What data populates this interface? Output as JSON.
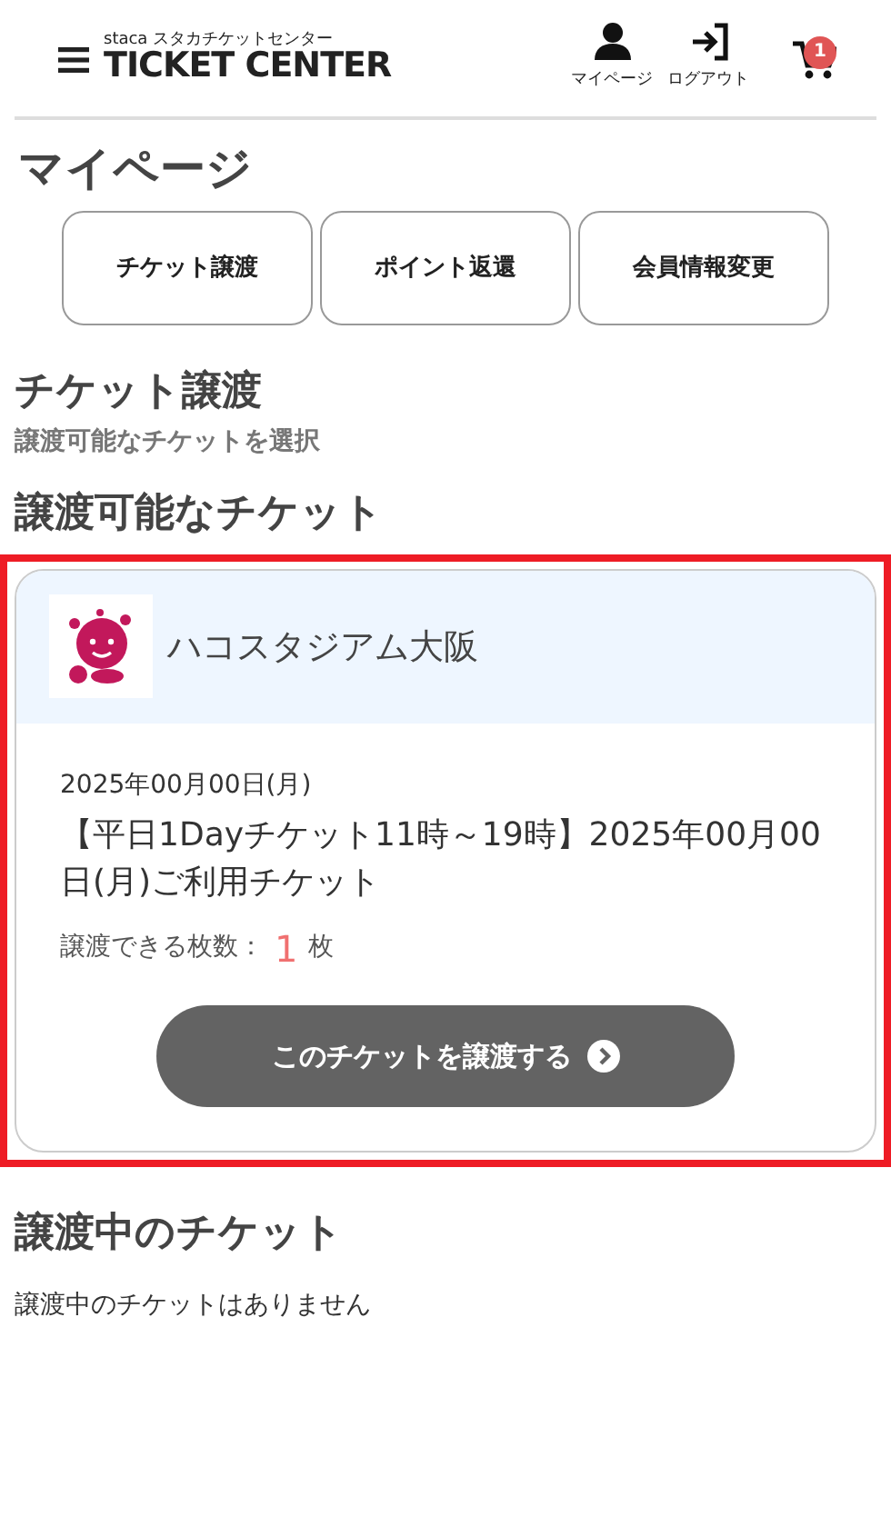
{
  "header": {
    "logo_small": "staca スタカチケットセンター",
    "logo_main": "TICKET CENTER",
    "nav": [
      {
        "kind": "user",
        "label": "マイページ"
      },
      {
        "kind": "logout",
        "label": "ログアウト"
      }
    ],
    "cart_count": "1"
  },
  "page_title": "マイページ",
  "tabs": [
    {
      "label": "チケット譲渡"
    },
    {
      "label": "ポイント返還"
    },
    {
      "label": "会員情報変更"
    }
  ],
  "section": {
    "title": "チケット譲渡",
    "subtitle": "譲渡可能なチケットを選択"
  },
  "transferable": {
    "title": "譲渡可能なチケット",
    "tickets": [
      {
        "highlighted": true,
        "venue": "ハコスタジアム大阪",
        "date": "2025年00月00日(月)",
        "name": "【平日1Dayチケット11時～19時】2025年00月00日(月)ご利用チケット",
        "count_label": "譲渡できる枚数：",
        "count": "1",
        "count_unit": "枚",
        "button": "このチケットを譲渡する"
      }
    ]
  },
  "in_transfer": {
    "title": "譲渡中のチケット",
    "empty_text": "譲渡中のチケットはありません"
  }
}
